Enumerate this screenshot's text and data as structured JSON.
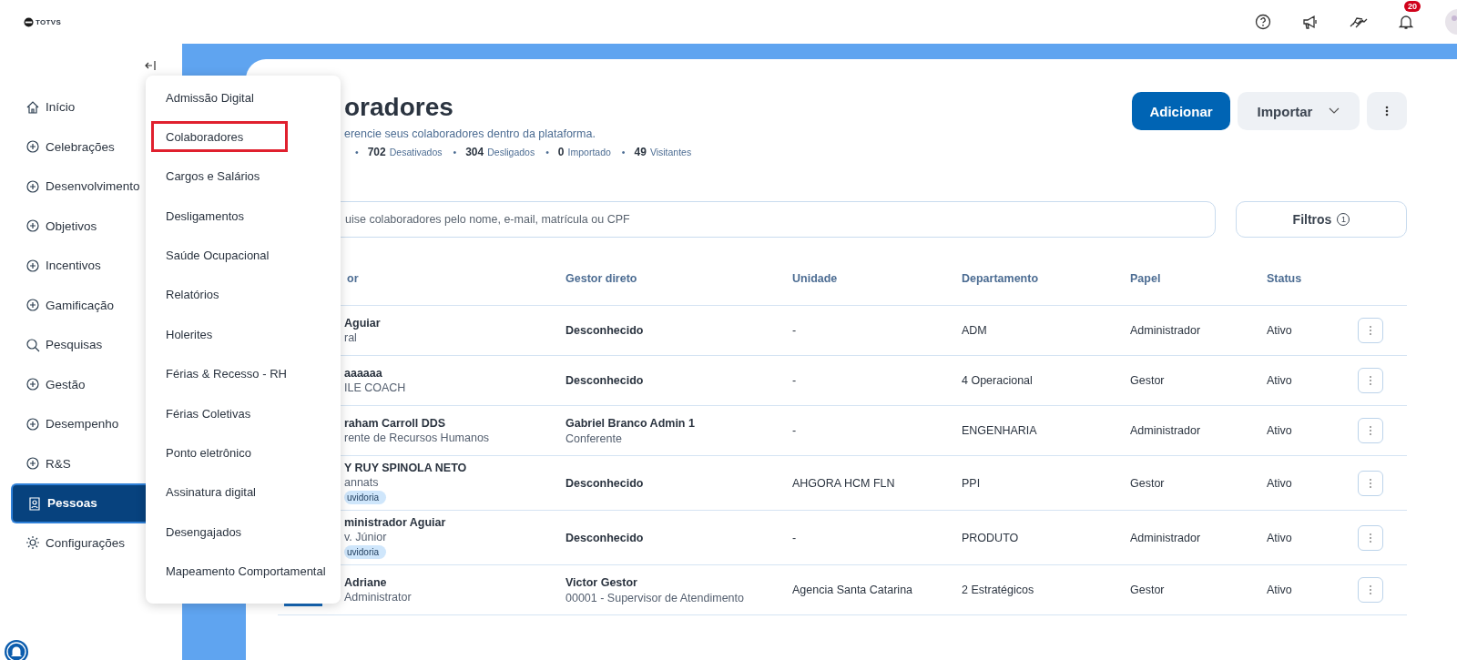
{
  "logo": "TOTVS",
  "topbar": {
    "notification_count": "20"
  },
  "sidebar": {
    "items": [
      {
        "label": "Início",
        "selected": false
      },
      {
        "label": "Celebrações",
        "selected": false
      },
      {
        "label": "Desenvolvimento",
        "selected": false
      },
      {
        "label": "Objetivos",
        "selected": false
      },
      {
        "label": "Incentivos",
        "selected": false
      },
      {
        "label": "Gamificação",
        "selected": false
      },
      {
        "label": "Pesquisas",
        "selected": false
      },
      {
        "label": "Gestão",
        "selected": false
      },
      {
        "label": "Desempenho",
        "selected": false
      },
      {
        "label": "R&S",
        "selected": false
      },
      {
        "label": "Pessoas",
        "selected": true
      },
      {
        "label": "Configurações",
        "selected": false
      }
    ]
  },
  "submenu": {
    "items": [
      {
        "label": "Admissão Digital",
        "selected": false
      },
      {
        "label": "Colaboradores",
        "selected": true
      },
      {
        "label": "Cargos e Salários",
        "selected": false
      },
      {
        "label": "Desligamentos",
        "selected": false
      },
      {
        "label": "Saúde Ocupacional",
        "selected": false
      },
      {
        "label": "Relatórios",
        "selected": false
      },
      {
        "label": "Holerites",
        "selected": false
      },
      {
        "label": "Férias & Recesso - RH",
        "selected": false
      },
      {
        "label": "Férias Coletivas",
        "selected": false
      },
      {
        "label": "Ponto eletrônico",
        "selected": false
      },
      {
        "label": "Assinatura digital",
        "selected": false
      },
      {
        "label": "Desengajados",
        "selected": false
      },
      {
        "label": "Mapeamento Comportamental",
        "selected": false
      }
    ]
  },
  "page": {
    "title": "oradores",
    "subtitle": "erencie seus colaboradores dentro da plataforma.",
    "stats": [
      {
        "bullet": "•",
        "value": "702",
        "label": "Desativados"
      },
      {
        "bullet": "•",
        "value": "304",
        "label": "Desligados"
      },
      {
        "bullet": "•",
        "value": "0",
        "label": "Importado"
      },
      {
        "bullet": "•",
        "value": "49",
        "label": "Visitantes"
      }
    ],
    "buttons": {
      "add": "Adicionar",
      "import": "Importar"
    },
    "search": {
      "placeholder": "uise colaboradores pelo nome, e-mail, matrícula ou CPF"
    },
    "filters": {
      "label": "Filtros",
      "count": "1"
    }
  },
  "table": {
    "columns": [
      "or",
      "Gestor direto",
      "Unidade",
      "Departamento",
      "Papel",
      "Status"
    ],
    "rows": [
      {
        "name": "Aguiar",
        "role": "ral",
        "manager": "Desconhecido",
        "unit": "-",
        "department": "ADM",
        "papel": "Administrador",
        "status": "Ativo"
      },
      {
        "name": "aaaaaa",
        "role": "ILE COACH",
        "manager": "Desconhecido",
        "unit": "-",
        "department": "4 Operacional",
        "papel": "Gestor",
        "status": "Ativo"
      },
      {
        "name": "raham Carroll DDS",
        "role": "rente de Recursos Humanos",
        "manager": "Gabriel Branco Admin 1",
        "manager_role": "Conferente",
        "unit": "-",
        "department": "ENGENHARIA",
        "papel": "Administrador",
        "status": "Ativo"
      },
      {
        "name": "Y RUY SPINOLA NETO",
        "role": "annats",
        "tag": "uvidoria",
        "manager": "Desconhecido",
        "unit": "AHGORA HCM FLN",
        "department": "PPI",
        "papel": "Gestor",
        "status": "Ativo"
      },
      {
        "name": "ministrador Aguiar",
        "role": "v. Júnior",
        "tag": "uvidoria",
        "manager": "Desconhecido",
        "unit": "-",
        "department": "PRODUTO",
        "papel": "Administrador",
        "status": "Ativo"
      },
      {
        "name": "Adriane",
        "role": "Administrator",
        "manager": "Victor Gestor",
        "manager_role": "00001 - Supervisor de Atendimento",
        "unit": "Agencia Santa Catarina",
        "department": "2 Estratégicos",
        "papel": "Gestor",
        "status": "Ativo"
      }
    ]
  }
}
